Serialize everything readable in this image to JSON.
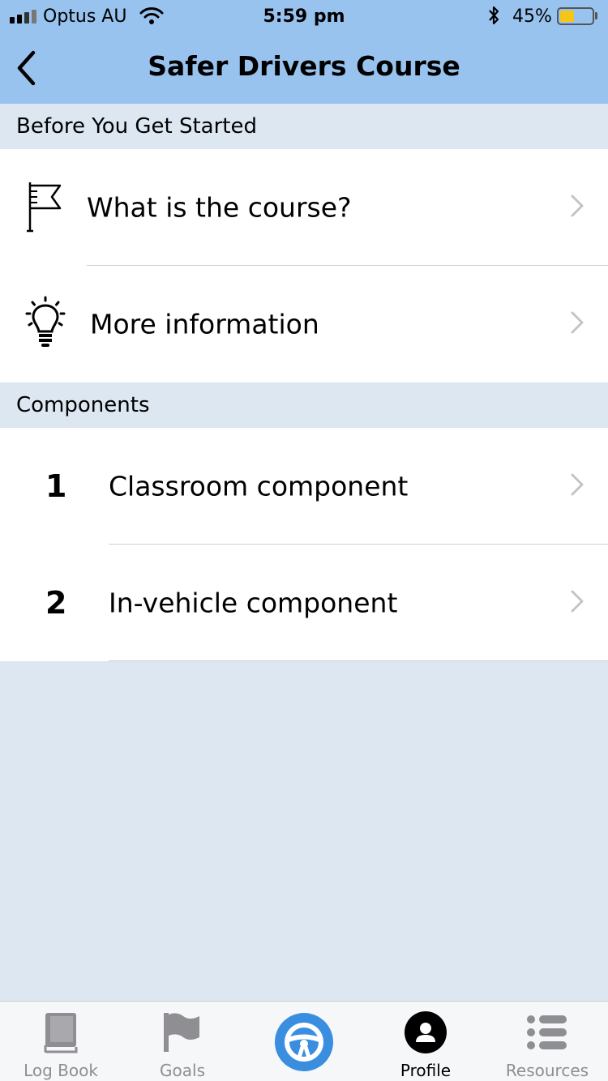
{
  "status_bar": {
    "carrier": "Optus AU",
    "time": "5:59 pm",
    "battery_percent": "45%",
    "battery_level": 0.45
  },
  "header": {
    "title": "Safer Drivers Course",
    "back_icon": "chevron-left-icon"
  },
  "sections": {
    "before": {
      "title": "Before You Get Started",
      "items": [
        {
          "label": "What is the course?",
          "icon": "flag-icon"
        },
        {
          "label": "More information",
          "icon": "lightbulb-icon"
        }
      ]
    },
    "components": {
      "title": "Components",
      "items": [
        {
          "number": "1",
          "label": "Classroom component"
        },
        {
          "number": "2",
          "label": "In-vehicle component"
        }
      ]
    }
  },
  "tab_bar": {
    "tabs": [
      {
        "label": "Log Book",
        "icon": "book-icon",
        "active": false
      },
      {
        "label": "Goals",
        "icon": "flag-icon",
        "active": false
      },
      {
        "label": "",
        "icon": "steering-wheel-icon",
        "active": false
      },
      {
        "label": "Profile",
        "icon": "user-icon",
        "active": true
      },
      {
        "label": "Resources",
        "icon": "list-icon",
        "active": false
      }
    ]
  },
  "colors": {
    "header_bg": "#99c3ef",
    "page_bg": "#dce7f1",
    "accent_blue": "#3a8ee0",
    "tab_inactive": "#8e8e93"
  }
}
